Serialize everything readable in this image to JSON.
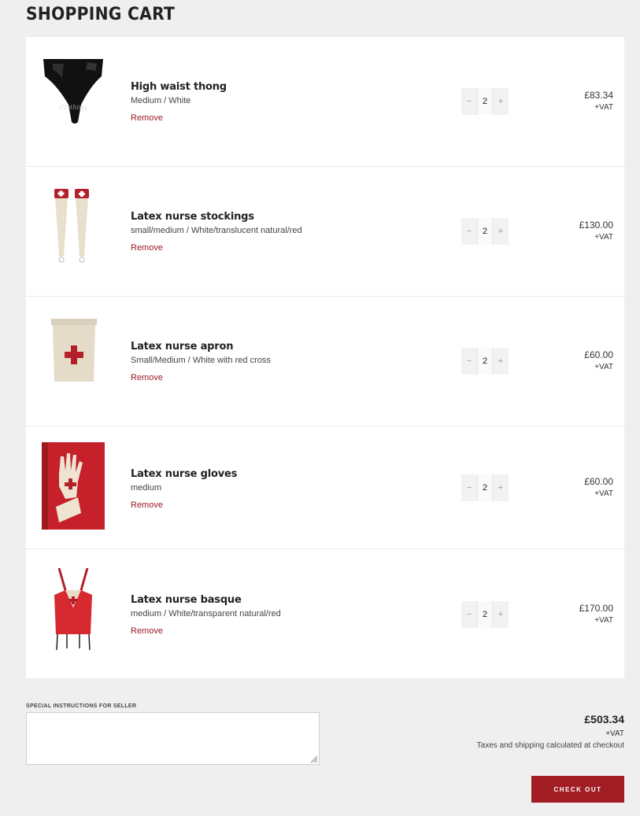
{
  "page": {
    "title": "SHOPPING CART"
  },
  "cart": {
    "items": [
      {
        "name": "High waist thong",
        "variant": "Medium / White",
        "remove_label": "Remove",
        "quantity": "2",
        "price": "£83.34",
        "tax_note": "+VAT",
        "minus": "−",
        "plus": "+",
        "image_icon": "black-thong-image"
      },
      {
        "name": "Latex nurse stockings",
        "variant": "small/medium / White/translucent natural/red",
        "remove_label": "Remove",
        "quantity": "2",
        "price": "£130.00",
        "tax_note": "+VAT",
        "minus": "−",
        "plus": "+",
        "image_icon": "nurse-stockings-image"
      },
      {
        "name": "Latex nurse apron",
        "variant": "Small/Medium / White with red cross",
        "remove_label": "Remove",
        "quantity": "2",
        "price": "£60.00",
        "tax_note": "+VAT",
        "minus": "−",
        "plus": "+",
        "image_icon": "nurse-apron-image"
      },
      {
        "name": "Latex nurse gloves",
        "variant": "medium",
        "remove_label": "Remove",
        "quantity": "2",
        "price": "£60.00",
        "tax_note": "+VAT",
        "minus": "−",
        "plus": "+",
        "image_icon": "nurse-gloves-image"
      },
      {
        "name": "Latex nurse basque",
        "variant": "medium / White/transparent natural/red",
        "remove_label": "Remove",
        "quantity": "2",
        "price": "£170.00",
        "tax_note": "+VAT",
        "minus": "−",
        "plus": "+",
        "image_icon": "nurse-basque-image"
      }
    ]
  },
  "instructions": {
    "label": "SPECIAL INSTRUCTIONS FOR SELLER",
    "value": ""
  },
  "totals": {
    "subtotal": "£503.34",
    "tax_note": "+VAT",
    "shipping_note": "Taxes and shipping calculated at checkout"
  },
  "checkout": {
    "label": "CHECK OUT"
  },
  "colors": {
    "accent": "#a11c23",
    "background": "#efefef",
    "panel": "#ffffff"
  }
}
